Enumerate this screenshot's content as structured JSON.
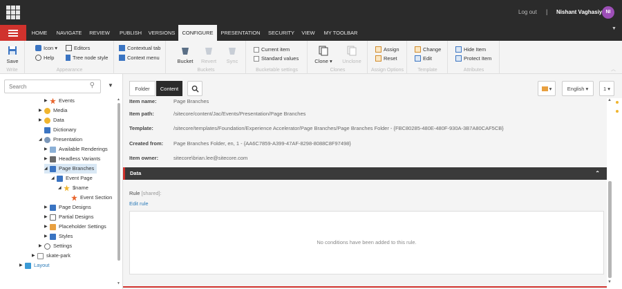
{
  "topbar": {
    "logout": "Log out",
    "separator": "|",
    "user": "Nishant Vaghasiya",
    "avatar": "NI"
  },
  "ribbon_tabs": [
    "HOME",
    "NAVIGATE",
    "REVIEW",
    "PUBLISH",
    "VERSIONS",
    "CONFIGURE",
    "PRESENTATION",
    "SECURITY",
    "VIEW",
    "MY TOOLBAR"
  ],
  "active_tab": "CONFIGURE",
  "ribbon": {
    "write": {
      "label": "Write",
      "save": "Save"
    },
    "appearance": {
      "label": "Appearance",
      "icon": "Icon",
      "help": "Help",
      "editors": "Editors",
      "tree_node_style": "Tree node style"
    },
    "contextual": {
      "contextual_tab": "Contextual tab",
      "context_menu": "Context menu"
    },
    "buckets": {
      "label": "Buckets",
      "bucket": "Bucket",
      "revert": "Revert",
      "sync": "Sync"
    },
    "bucketable": {
      "label": "Bucketable settings",
      "current_item": "Current item",
      "standard_values": "Standard values"
    },
    "clones": {
      "label": "Clones",
      "clone": "Clone",
      "unclone": "Unclone"
    },
    "assign": {
      "label": "Assign Options",
      "assign": "Assign",
      "reset": "Reset"
    },
    "template": {
      "label": "Template",
      "change": "Change",
      "edit": "Edit"
    },
    "attributes": {
      "label": "Attributes",
      "hide_item": "Hide Item",
      "protect_item": "Protect Item"
    }
  },
  "search": {
    "placeholder": "Search"
  },
  "tree": [
    {
      "label": "Events",
      "icon": "star-icon",
      "color": "#e8642c"
    },
    {
      "label": "Media",
      "icon": "lightbulb-icon",
      "color": "#f0b52e"
    },
    {
      "label": "Data",
      "icon": "lightbulb-icon",
      "color": "#f0b52e"
    },
    {
      "label": "Dictionary",
      "icon": "book-icon",
      "color": "#3a74c2"
    },
    {
      "label": "Presentation",
      "icon": "presentation-icon",
      "color": "#7a96b8"
    },
    {
      "label": "Available Renderings",
      "icon": "renderings-icon",
      "color": "#8bb0d6"
    },
    {
      "label": "Headless Variants",
      "icon": "variants-icon",
      "color": "#6a6a6a"
    },
    {
      "label": "Page Branches",
      "icon": "branch-icon",
      "color": "#3a74c2"
    },
    {
      "label": "Event Page",
      "icon": "page-icon",
      "color": "#3a74c2"
    },
    {
      "label": "$name",
      "icon": "star-icon",
      "color": "#f0b52e"
    },
    {
      "label": "Event Section",
      "icon": "star-icon",
      "color": "#e8642c"
    },
    {
      "label": "Page Designs",
      "icon": "page-design-icon",
      "color": "#3a74c2"
    },
    {
      "label": "Partial Designs",
      "icon": "partial-design-icon",
      "color": "#666"
    },
    {
      "label": "Placeholder Settings",
      "icon": "placeholder-icon",
      "color": "#e8a040"
    },
    {
      "label": "Styles",
      "icon": "styles-icon",
      "color": "#3a74c2"
    },
    {
      "label": "Settings",
      "icon": "settings-icon",
      "color": "#666"
    },
    {
      "label": "skate-park",
      "icon": "site-icon",
      "color": "#888"
    },
    {
      "label": "Layout",
      "icon": "layout-icon",
      "color": "#3a9ad6"
    }
  ],
  "content_tabs": {
    "folder": "Folder",
    "content": "Content"
  },
  "content_toolbar": {
    "language": "English",
    "version": "1"
  },
  "quick_info": {
    "item_name_label": "Item name:",
    "item_name": "Page Branches",
    "item_path_label": "Item path:",
    "item_path": "/sitecore/content/Jac/Events/Presentation/Page Branches",
    "template_label": "Template:",
    "template": "/sitecore/templates/Foundation/Experience Accelerator/Page Branches/Page Branches Folder - {FBC80285-480E-480F-930A-3B7A80CAF5CB}",
    "created_from_label": "Created from:",
    "created_from": "Page Branches Folder, en, 1 - {AA6C7859-A399-47AF-8298-8088C8F97498}",
    "item_owner_label": "Item owner:",
    "item_owner": "sitecore\\brian.lee@sitecore.com"
  },
  "data_section": {
    "title": "Data",
    "rule_label": "Rule",
    "rule_shared": "[shared]:",
    "edit_rule": "Edit rule",
    "empty_message": "No conditions have been added to this rule."
  }
}
